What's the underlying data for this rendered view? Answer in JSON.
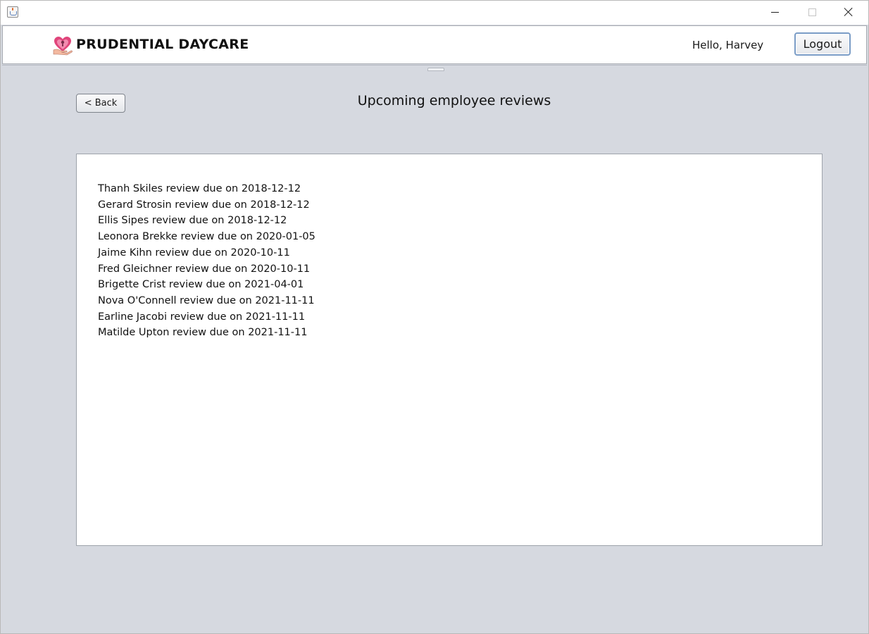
{
  "window": {
    "icon": "java-cup-icon",
    "controls": [
      "minimize-icon",
      "maximize-icon",
      "close-icon"
    ]
  },
  "header": {
    "brand": "PRUDENTIAL DAYCARE",
    "logo_icon": "heart-hand-logo-icon",
    "greeting": "Hello, Harvey",
    "logout_label": "Logout"
  },
  "page": {
    "back_label": "< Back",
    "title": "Upcoming employee reviews"
  },
  "reviews": [
    "Thanh Skiles review due on 2018-12-12",
    "Gerard Strosin review due on 2018-12-12",
    "Ellis Sipes review due on 2018-12-12",
    "Leonora Brekke review due on 2020-01-05",
    "Jaime Kihn review due on 2020-10-11",
    "Fred Gleichner review due on 2020-10-11",
    "Brigette Crist review due on 2021-04-01",
    "Nova O'Connell review due on 2021-11-11",
    "Earline Jacobi review due on 2021-11-11",
    "Matilde Upton review due on 2021-11-11"
  ],
  "colors": {
    "background": "#d6d9e0",
    "panel": "#ffffff",
    "button_focus_border": "#7a9cc6",
    "logo_heart": "#e0457b"
  }
}
